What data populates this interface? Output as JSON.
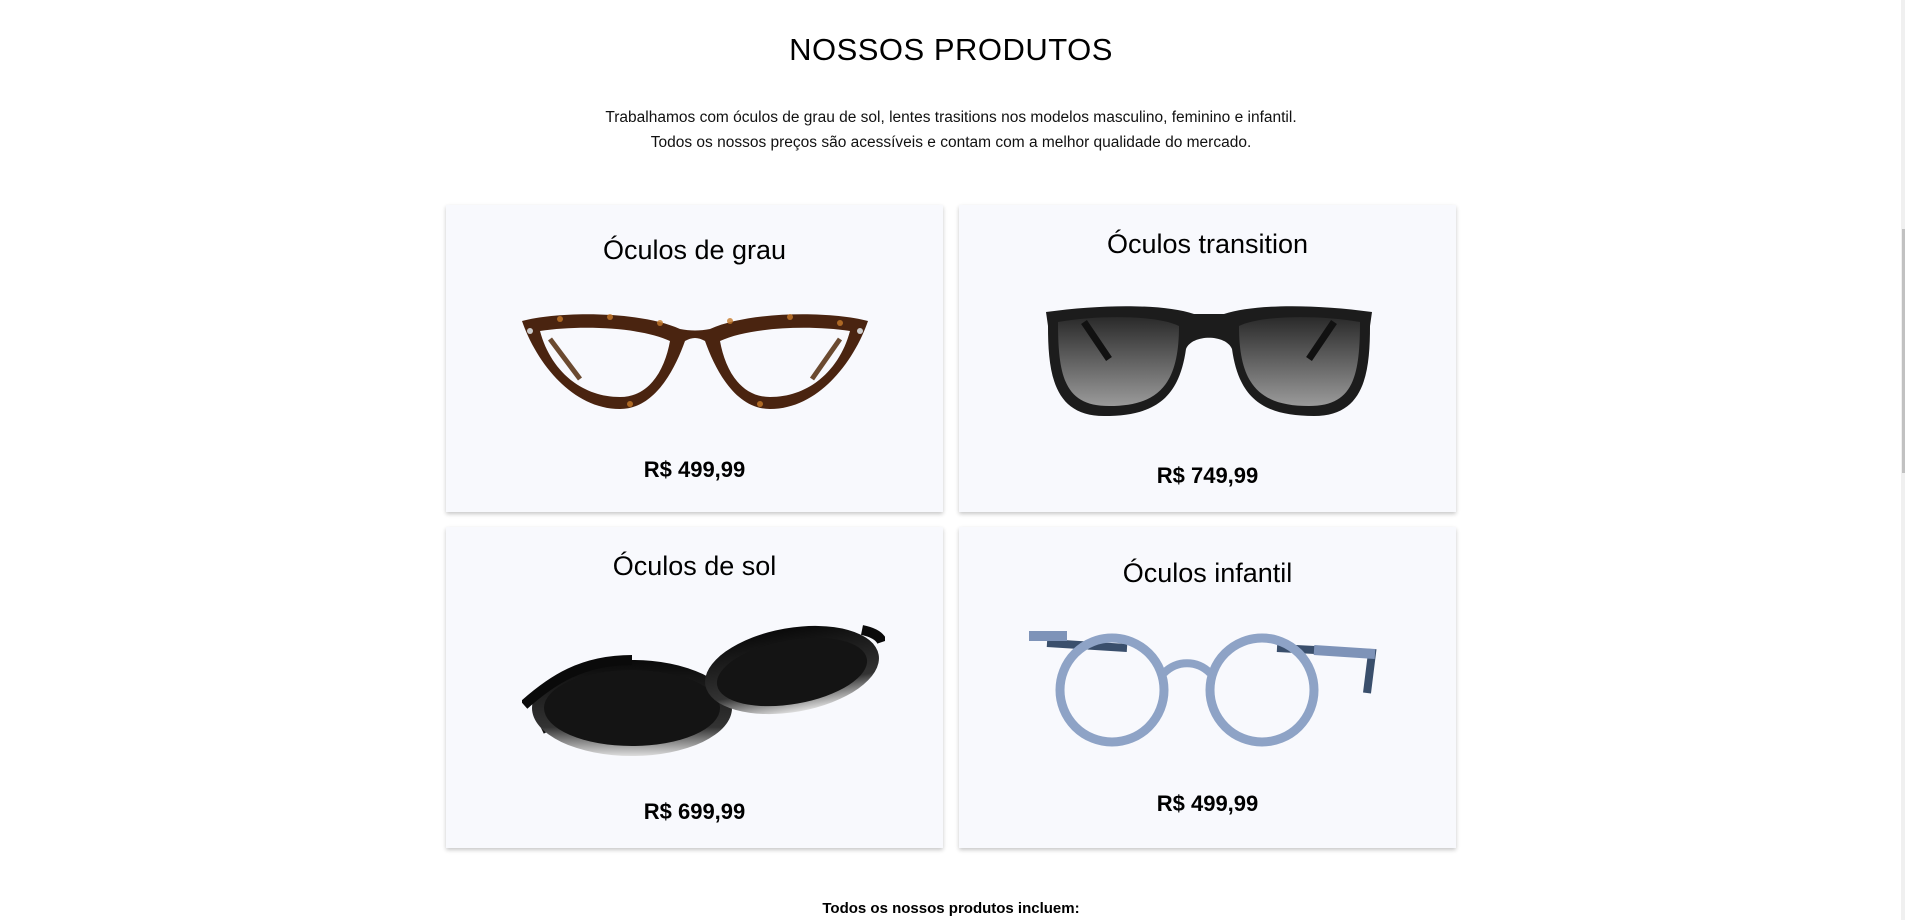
{
  "section": {
    "title": "NOSSOS PRODUTOS",
    "intro_lines": [
      "Trabalhamos com óculos de grau de sol, lentes trasitions nos modelos masculino, feminino e infantil.",
      "Todos os nossos preços são acessíveis e contam com a melhor qualidade do mercado."
    ]
  },
  "products": [
    {
      "title": "Óculos de grau",
      "price": "R$ 499,99",
      "icon": "tortoise-cat-eye-glasses"
    },
    {
      "title": "Óculos transition",
      "price": "R$ 749,99",
      "icon": "black-square-sunglasses"
    },
    {
      "title": "Óculos de sol",
      "price": "R$ 699,99",
      "icon": "black-round-sunglasses"
    },
    {
      "title": "Óculos infantil",
      "price": "R$ 499,99",
      "icon": "blue-round-glasses"
    }
  ],
  "footer": {
    "text": "Todos os nossos produtos incluem:"
  },
  "colors": {
    "card_bg": "#f8f9fd",
    "text": "#000000"
  }
}
